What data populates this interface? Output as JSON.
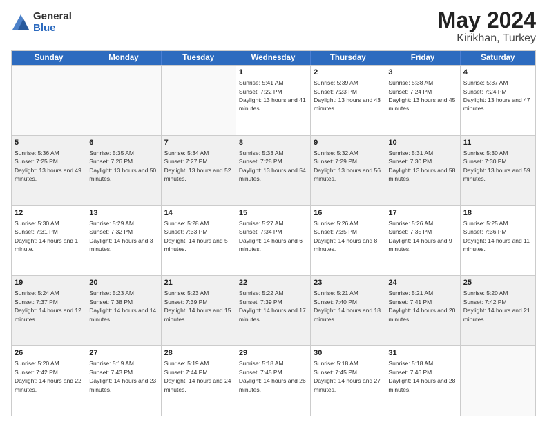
{
  "logo": {
    "general": "General",
    "blue": "Blue"
  },
  "title": {
    "month": "May 2024",
    "location": "Kirikhan, Turkey"
  },
  "header": {
    "days": [
      "Sunday",
      "Monday",
      "Tuesday",
      "Wednesday",
      "Thursday",
      "Friday",
      "Saturday"
    ]
  },
  "weeks": [
    [
      {
        "day": "",
        "empty": true
      },
      {
        "day": "",
        "empty": true
      },
      {
        "day": "",
        "empty": true
      },
      {
        "day": "1",
        "sunrise": "5:41 AM",
        "sunset": "7:22 PM",
        "daylight": "13 hours and 41 minutes."
      },
      {
        "day": "2",
        "sunrise": "5:39 AM",
        "sunset": "7:23 PM",
        "daylight": "13 hours and 43 minutes."
      },
      {
        "day": "3",
        "sunrise": "5:38 AM",
        "sunset": "7:24 PM",
        "daylight": "13 hours and 45 minutes."
      },
      {
        "day": "4",
        "sunrise": "5:37 AM",
        "sunset": "7:24 PM",
        "daylight": "13 hours and 47 minutes."
      }
    ],
    [
      {
        "day": "5",
        "sunrise": "5:36 AM",
        "sunset": "7:25 PM",
        "daylight": "13 hours and 49 minutes."
      },
      {
        "day": "6",
        "sunrise": "5:35 AM",
        "sunset": "7:26 PM",
        "daylight": "13 hours and 50 minutes."
      },
      {
        "day": "7",
        "sunrise": "5:34 AM",
        "sunset": "7:27 PM",
        "daylight": "13 hours and 52 minutes."
      },
      {
        "day": "8",
        "sunrise": "5:33 AM",
        "sunset": "7:28 PM",
        "daylight": "13 hours and 54 minutes."
      },
      {
        "day": "9",
        "sunrise": "5:32 AM",
        "sunset": "7:29 PM",
        "daylight": "13 hours and 56 minutes."
      },
      {
        "day": "10",
        "sunrise": "5:31 AM",
        "sunset": "7:30 PM",
        "daylight": "13 hours and 58 minutes."
      },
      {
        "day": "11",
        "sunrise": "5:30 AM",
        "sunset": "7:30 PM",
        "daylight": "13 hours and 59 minutes."
      }
    ],
    [
      {
        "day": "12",
        "sunrise": "5:30 AM",
        "sunset": "7:31 PM",
        "daylight": "14 hours and 1 minute."
      },
      {
        "day": "13",
        "sunrise": "5:29 AM",
        "sunset": "7:32 PM",
        "daylight": "14 hours and 3 minutes."
      },
      {
        "day": "14",
        "sunrise": "5:28 AM",
        "sunset": "7:33 PM",
        "daylight": "14 hours and 5 minutes."
      },
      {
        "day": "15",
        "sunrise": "5:27 AM",
        "sunset": "7:34 PM",
        "daylight": "14 hours and 6 minutes."
      },
      {
        "day": "16",
        "sunrise": "5:26 AM",
        "sunset": "7:35 PM",
        "daylight": "14 hours and 8 minutes."
      },
      {
        "day": "17",
        "sunrise": "5:26 AM",
        "sunset": "7:35 PM",
        "daylight": "14 hours and 9 minutes."
      },
      {
        "day": "18",
        "sunrise": "5:25 AM",
        "sunset": "7:36 PM",
        "daylight": "14 hours and 11 minutes."
      }
    ],
    [
      {
        "day": "19",
        "sunrise": "5:24 AM",
        "sunset": "7:37 PM",
        "daylight": "14 hours and 12 minutes."
      },
      {
        "day": "20",
        "sunrise": "5:23 AM",
        "sunset": "7:38 PM",
        "daylight": "14 hours and 14 minutes."
      },
      {
        "day": "21",
        "sunrise": "5:23 AM",
        "sunset": "7:39 PM",
        "daylight": "14 hours and 15 minutes."
      },
      {
        "day": "22",
        "sunrise": "5:22 AM",
        "sunset": "7:39 PM",
        "daylight": "14 hours and 17 minutes."
      },
      {
        "day": "23",
        "sunrise": "5:21 AM",
        "sunset": "7:40 PM",
        "daylight": "14 hours and 18 minutes."
      },
      {
        "day": "24",
        "sunrise": "5:21 AM",
        "sunset": "7:41 PM",
        "daylight": "14 hours and 20 minutes."
      },
      {
        "day": "25",
        "sunrise": "5:20 AM",
        "sunset": "7:42 PM",
        "daylight": "14 hours and 21 minutes."
      }
    ],
    [
      {
        "day": "26",
        "sunrise": "5:20 AM",
        "sunset": "7:42 PM",
        "daylight": "14 hours and 22 minutes."
      },
      {
        "day": "27",
        "sunrise": "5:19 AM",
        "sunset": "7:43 PM",
        "daylight": "14 hours and 23 minutes."
      },
      {
        "day": "28",
        "sunrise": "5:19 AM",
        "sunset": "7:44 PM",
        "daylight": "14 hours and 24 minutes."
      },
      {
        "day": "29",
        "sunrise": "5:18 AM",
        "sunset": "7:45 PM",
        "daylight": "14 hours and 26 minutes."
      },
      {
        "day": "30",
        "sunrise": "5:18 AM",
        "sunset": "7:45 PM",
        "daylight": "14 hours and 27 minutes."
      },
      {
        "day": "31",
        "sunrise": "5:18 AM",
        "sunset": "7:46 PM",
        "daylight": "14 hours and 28 minutes."
      },
      {
        "day": "",
        "empty": true
      }
    ]
  ]
}
